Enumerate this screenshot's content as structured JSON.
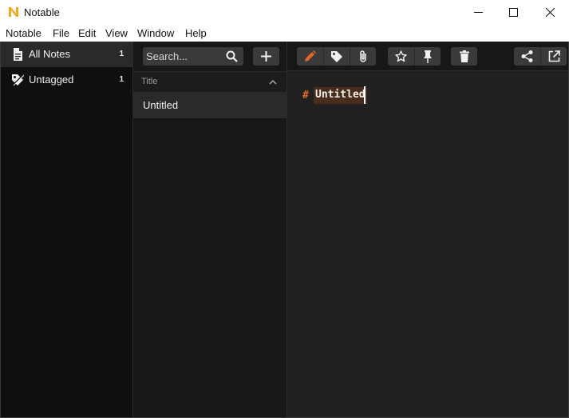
{
  "window": {
    "title": "Notable",
    "logo_letter": "N"
  },
  "menu": [
    "Notable",
    "File",
    "Edit",
    "View",
    "Window",
    "Help"
  ],
  "sidebar": {
    "items": [
      {
        "label": "All Notes",
        "count": "1",
        "icon": "document-icon",
        "active": true
      },
      {
        "label": "Untagged",
        "count": "1",
        "icon": "tag-off-icon",
        "active": false
      }
    ]
  },
  "notelist": {
    "search_placeholder": "Search...",
    "header_label": "Title",
    "notes": [
      {
        "title": "Untitled",
        "selected": true
      }
    ]
  },
  "toolbar": {
    "groups": [
      [
        "pencil-icon",
        "tag-icon",
        "paperclip-icon"
      ],
      [
        "star-icon",
        "pin-icon"
      ],
      [
        "trash-icon"
      ],
      [
        "share-icon",
        "open-external-icon"
      ]
    ]
  },
  "editor": {
    "heading_marker": "#",
    "heading_text": "Untitled"
  },
  "colors": {
    "accent": "#e0662c",
    "heading_highlight": "#4a2c1c",
    "logo": "#f2a91d"
  }
}
